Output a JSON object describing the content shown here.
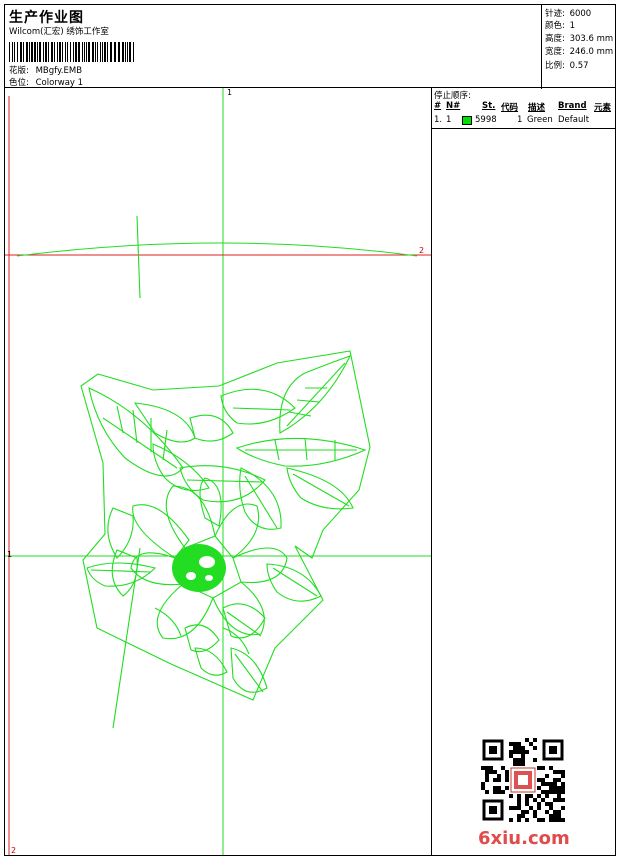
{
  "header": {
    "title": "生产作业图",
    "company": "Wilcom(汇宏) 绣饰工作室",
    "design_label": "花版:",
    "design_value": "MBgfy.EMB",
    "colorway_label": "色位:",
    "colorway_value": "Colorway 1"
  },
  "specs": {
    "stitches_label": "针迹:",
    "stitches_value": "6000",
    "colors_label": "颜色:",
    "colors_value": "1",
    "height_label": "高度:",
    "height_value": "303.6 mm",
    "width_label": "宽度:",
    "width_value": "246.0 mm",
    "scale_label": "比例:",
    "scale_value": "0.57"
  },
  "stop_sequence": {
    "title": "停止顺序:",
    "columns": [
      "#",
      "N#",
      "St.",
      "代码",
      "描述",
      "Brand",
      "元素"
    ],
    "rows": [
      {
        "index": "1.",
        "needle": "1",
        "stitches": "5998",
        "code": "1",
        "description": "Green",
        "brand": "Default",
        "color": "#00e000"
      }
    ]
  },
  "guides": {
    "top": "1",
    "right": "2",
    "left": "1",
    "bottom": "2"
  },
  "watermark": "6xiu.com",
  "design_color": "#22dd22",
  "guide_color_vertical": "#22dd22",
  "guide_color_horizontal": "#dd2222"
}
